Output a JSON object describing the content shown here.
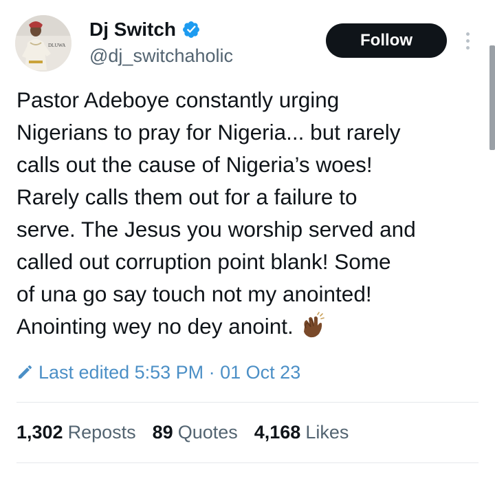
{
  "author": {
    "display_name": "Dj Switch",
    "handle": "@dj_switchaholic",
    "avatar_caption": "DLUWA",
    "verified": true
  },
  "actions": {
    "follow_label": "Follow"
  },
  "tweet": {
    "text": "Pastor Adeboye constantly urging\nNigerians to pray for Nigeria...  but rarely\ncalls out the cause of Nigeria’s woes!\nRarely calls them out for a failure to\nserve. The Jesus you worship served and\ncalled out corruption point blank! Some\nof una go say touch not my anointed!\nAnointing wey no dey anoint.",
    "emoji": "clapping-hands"
  },
  "edited": {
    "text": "Last edited 5:53 PM · 01 Oct 23"
  },
  "stats": [
    {
      "count": "1,302",
      "label": "Reposts"
    },
    {
      "count": "89",
      "label": "Quotes"
    },
    {
      "count": "4,168",
      "label": "Likes"
    }
  ],
  "colors": {
    "verified": "#1d9bf0",
    "follow_bg": "#0f1419",
    "edited": "#4b8fc6",
    "muted": "#536471"
  }
}
